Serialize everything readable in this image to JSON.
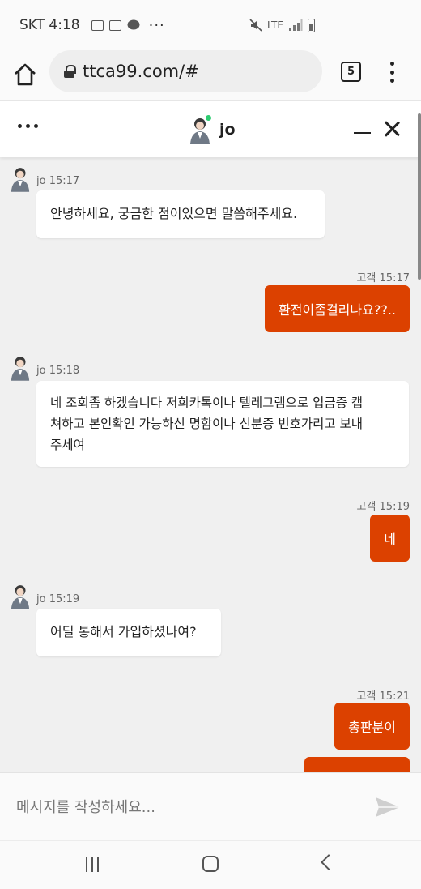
{
  "status_bar": {
    "carrier_time": "SKT 4:18",
    "overflow": "···",
    "network": "LTE"
  },
  "browser": {
    "url": "ttca99.com/#",
    "tab_count": "5"
  },
  "chat": {
    "agent_name": "jo",
    "agent_online": true,
    "messages": [
      {
        "sender": "agent",
        "meta": "jo 15:17",
        "text": "안녕하세요, 궁금한 점이있으면 말씀해주세요."
      },
      {
        "sender": "customer",
        "meta": "고객 15:17",
        "text": "환전이좀걸리나요??.."
      },
      {
        "sender": "agent",
        "meta": "jo 15:18",
        "lines": [
          "네 조회좀 하겠습니다 저희카톡이나 텔레그램으로 입금증 캡",
          "쳐하고 본인확인 가능하신 명함이나 신분증 번호가리고 보내",
          "주세여"
        ]
      },
      {
        "sender": "customer",
        "meta": "고객 15:19",
        "text": "네"
      },
      {
        "sender": "agent",
        "meta": "jo 15:19",
        "text": "어딜 통해서 가입하셨나여?"
      },
      {
        "sender": "customer",
        "meta": "고객 15:21",
        "text": "총판분이"
      }
    ]
  },
  "input": {
    "placeholder": "메시지를 작성하세요..."
  },
  "colors": {
    "accent": "#dc4100",
    "online": "#2ecc71"
  },
  "icons": [
    "home-icon",
    "lock-icon",
    "tabs-icon",
    "more-vertical-icon",
    "more-horizontal-icon",
    "minimize-icon",
    "close-icon",
    "send-icon",
    "nav-recent-icon",
    "nav-home-icon",
    "nav-back-icon"
  ]
}
